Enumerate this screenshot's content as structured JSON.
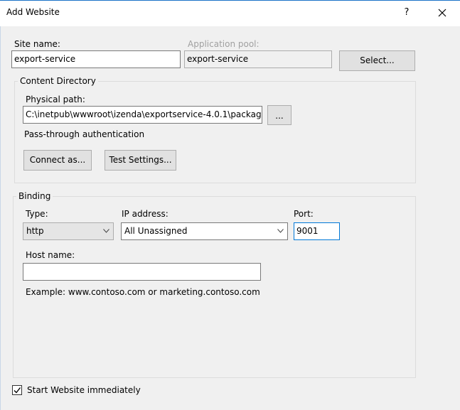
{
  "dialog": {
    "title": "Add Website",
    "help_label": "?"
  },
  "site": {
    "site_name_label": "Site name:",
    "site_name_value": "export-service",
    "app_pool_label": "Application pool:",
    "app_pool_value": "export-service",
    "select_button": "Select..."
  },
  "content_directory": {
    "legend": "Content Directory",
    "physical_path_label": "Physical path:",
    "physical_path_value": "C:\\inetpub\\wwwroot\\izenda\\exportservice-4.0.1\\packag",
    "browse_button": "...",
    "pass_through_label": "Pass-through authentication",
    "connect_as_button": "Connect as...",
    "test_settings_button": "Test Settings..."
  },
  "binding": {
    "legend": "Binding",
    "type_label": "Type:",
    "type_value": "http",
    "ip_label": "IP address:",
    "ip_value": "All Unassigned",
    "port_label": "Port:",
    "port_value": "9001",
    "host_name_label": "Host name:",
    "host_name_value": "",
    "example_text": "Example: www.contoso.com or marketing.contoso.com"
  },
  "footer": {
    "start_immediately_label": "Start Website immediately",
    "start_immediately_checked": true
  },
  "colors": {
    "accent": "#0078d7",
    "titlebar_border": "#1a73c7",
    "dialog_bg": "#f0f0f0"
  },
  "icons": [
    "close-icon",
    "chevron-down-icon",
    "checkmark-icon"
  ]
}
